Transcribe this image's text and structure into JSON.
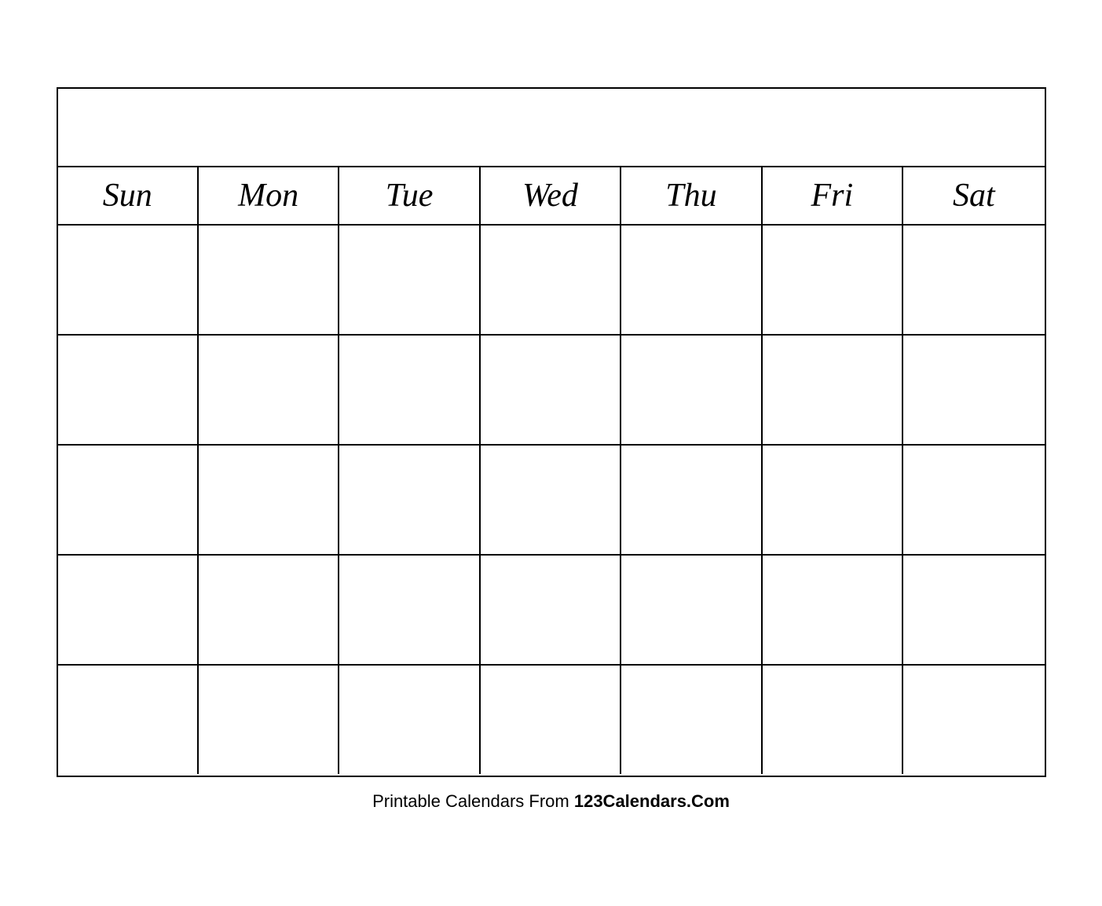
{
  "calendar": {
    "title": "",
    "days": [
      "Sun",
      "Mon",
      "Tue",
      "Wed",
      "Thu",
      "Fri",
      "Sat"
    ],
    "rows": 5,
    "footer_text": "Printable Calendars From ",
    "footer_brand": "123Calendars.Com"
  }
}
